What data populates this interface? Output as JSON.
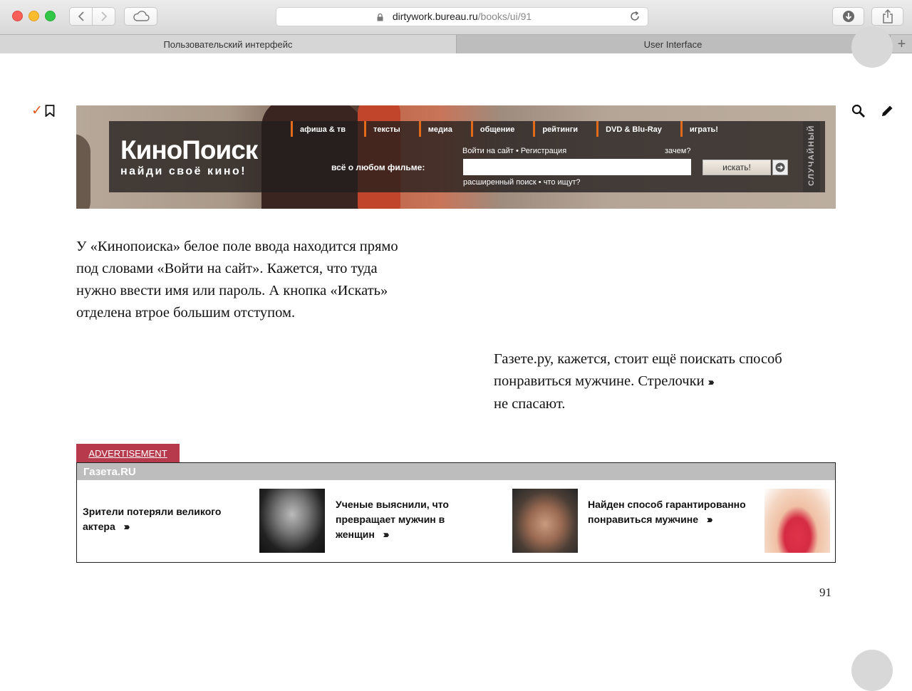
{
  "browser": {
    "url_host": "dirtywork.bureau.ru",
    "url_path": "/books/ui/91",
    "tabs": [
      {
        "label": "Пользовательский интерфейс"
      },
      {
        "label": "User Interface"
      }
    ],
    "new_tab": "+"
  },
  "page": {
    "bookmark_check": "✓",
    "kinopoisk": {
      "logo": "КиноПоиск",
      "slogan": "найди своё кино!",
      "menu": [
        "афиша & тв",
        "тексты",
        "медиа",
        "общение",
        "рейтинги",
        "DVD & Blu-Ray",
        "играть!"
      ],
      "about_label": "всё о любом фильме:",
      "login_link": "Войти на сайт",
      "register_link": "Регистрация",
      "why_link": "зачем?",
      "search_button": "искать!",
      "advanced_link": "расширенный поиск",
      "what_link": "что ищут?",
      "random_label": "СЛУЧАЙНЫЙ"
    },
    "paragraph_1": "У «Кинопоиска» белое поле ввода находится прямо под словами «Войти на сайт». Кажется, что туда нужно ввести имя или пароль. А кнопка «Искать» отделена втрое большим отступом.",
    "paragraph_2_a": "Газете.ру, кажется, стоит ещё поискать способ понравиться мужчине. Стрелочки",
    "paragraph_2_b": "не спасают.",
    "chevrons": "›››",
    "advertisement": {
      "label": "ADVERTISEMENT",
      "header": "Газета.RU",
      "items": [
        {
          "text": "Зрители потеряли великого актера"
        },
        {
          "text": "Ученые выяснили, что превращает мужчин в женщин"
        },
        {
          "text": "Найден способ гарантированно понравиться мужчине"
        }
      ]
    },
    "page_number": "91"
  }
}
